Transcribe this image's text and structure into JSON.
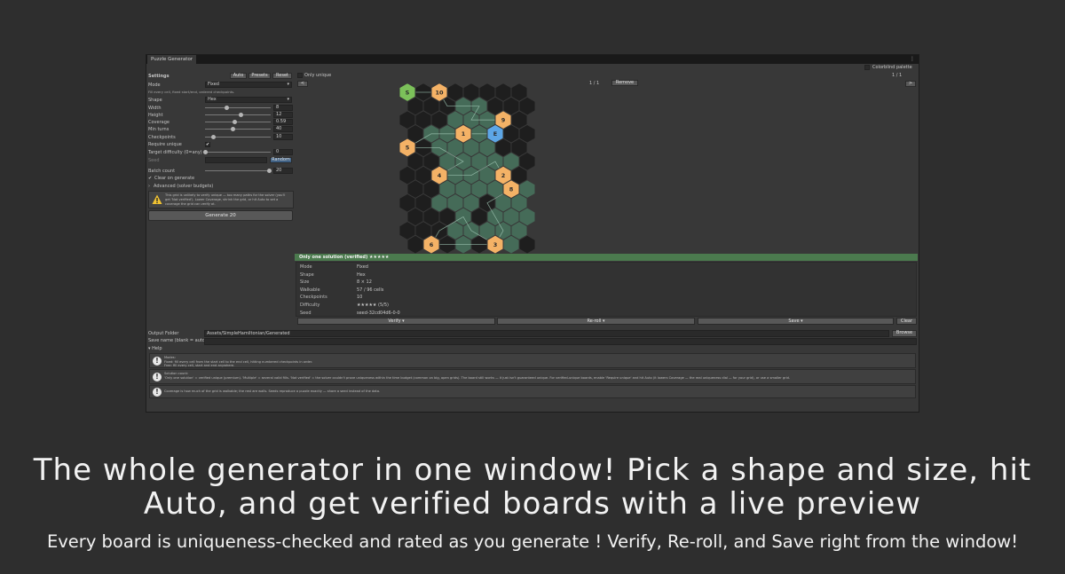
{
  "window": {
    "tab_title": "Puzzle Generator",
    "menu_glyph": "⋮",
    "colorblind_label": "Colorblind palette"
  },
  "settings": {
    "title": "Settings",
    "auto_label": "Auto",
    "presets_label": "Presets",
    "reset_label": "Reset",
    "mode_label": "Mode",
    "mode_value": "Fixed",
    "mode_desc": "Fill every cell, fixed start/end, ordered checkpoints.",
    "shape_label": "Shape",
    "shape_value": "Hex",
    "width_label": "Width",
    "width_value": "8",
    "height_label": "Height",
    "height_value": "12",
    "coverage_label": "Coverage",
    "coverage_value": "0.59",
    "minturns_label": "Min turns",
    "minturns_value": "40",
    "checkpoints_label": "Checkpoints",
    "checkpoints_value": "10",
    "require_unique_label": "Require unique",
    "target_difficulty_label": "Target difficulty (0=any)",
    "target_difficulty_value": "0",
    "seed_label": "Seed",
    "random_label": "Random",
    "batch_label": "Batch count",
    "batch_value": "20",
    "clear_on_generate_label": "Clear on generate",
    "advanced_label": "Advanced (solver budgets)",
    "warning_text": "This grid is unlikely to verify unique — too many paths for the solver (you'll get 'Not verified'). Lower Coverage, shrink the grid, or hit Auto to set a coverage the grid can verify at.",
    "generate_label": "Generate 20"
  },
  "preview": {
    "only_unique_label": "Only unique",
    "prev_label": "<",
    "next_label": ">",
    "page_left": "1 / 1",
    "page_right": "1 / 1",
    "remove_label": "Remove"
  },
  "board": {
    "start_label": "S",
    "end_label": "E",
    "checkpoints": [
      "1",
      "2",
      "3",
      "4",
      "5",
      "6",
      "7",
      "8",
      "9",
      "10"
    ]
  },
  "result": {
    "status": "Only one solution (verified)  ★★★★★",
    "rows": [
      {
        "k": "Mode",
        "v": "Fixed"
      },
      {
        "k": "Shape",
        "v": "Hex"
      },
      {
        "k": "Size",
        "v": "8 × 12"
      },
      {
        "k": "Walkable",
        "v": "57 / 96 cells"
      },
      {
        "k": "Checkpoints",
        "v": "10"
      },
      {
        "k": "Difficulty",
        "v": "★★★★★ (5/5)"
      },
      {
        "k": "Seed",
        "v": "seed-32cd04d6-0-0"
      }
    ],
    "verify_label": "Verify ▾",
    "reroll_label": "Re-roll ▾",
    "save_label": "Save ▾",
    "clear_label": "Clear"
  },
  "output": {
    "folder_label": "Output Folder",
    "folder_value": "Assets/SimpleHamiltonian/Generated",
    "browse_label": "Browse",
    "save_name_label": "Save name (blank = auto)"
  },
  "help": {
    "title": "Help",
    "items": [
      "Modes:\nFixed: fill every cell from the start cell to the end cell, hitting numbered checkpoints in order.\nFree: fill every cell, start and end anywhere.",
      "Solution count:\n'Only one solution' = verified unique (premium). 'Multiple' = several valid fills. 'Not verified' = the solver couldn't prove uniqueness within the time budget (common on big, open grids). The board still works — it just isn't guaranteed unique. For verified-unique boards, enable 'Require unique' and hit Auto (it lowers Coverage — the real uniqueness dial — for your grid), or use a smaller grid.",
      "Coverage is how much of the grid is walkable; the rest are walls. Seeds reproduce a puzzle exactly — share a seed instead of the data."
    ]
  },
  "caption": {
    "line1a": "The whole generator in one window! Pick a shape and size, hit",
    "line1b": "Auto, and get verified boards with a live preview",
    "line2": "Every board is uniqueness-checked and rated as you generate ! Verify, Re-roll, and Save right from the window!"
  },
  "colors": {
    "panel_bg": "#383838",
    "status_green": "#4b7a4e",
    "hex_wall": "#1e1e1e",
    "hex_path": "#456b58",
    "hex_checkpoint": "#f4b266",
    "hex_start": "#7cc15a",
    "hex_end": "#5da6e6"
  },
  "sliders": {
    "width": 0.33,
    "height": 0.55,
    "coverage": 0.45,
    "min_turns": 0.42,
    "checkpoints": 0.13,
    "target_difficulty": 0.0,
    "batch": 0.98
  }
}
